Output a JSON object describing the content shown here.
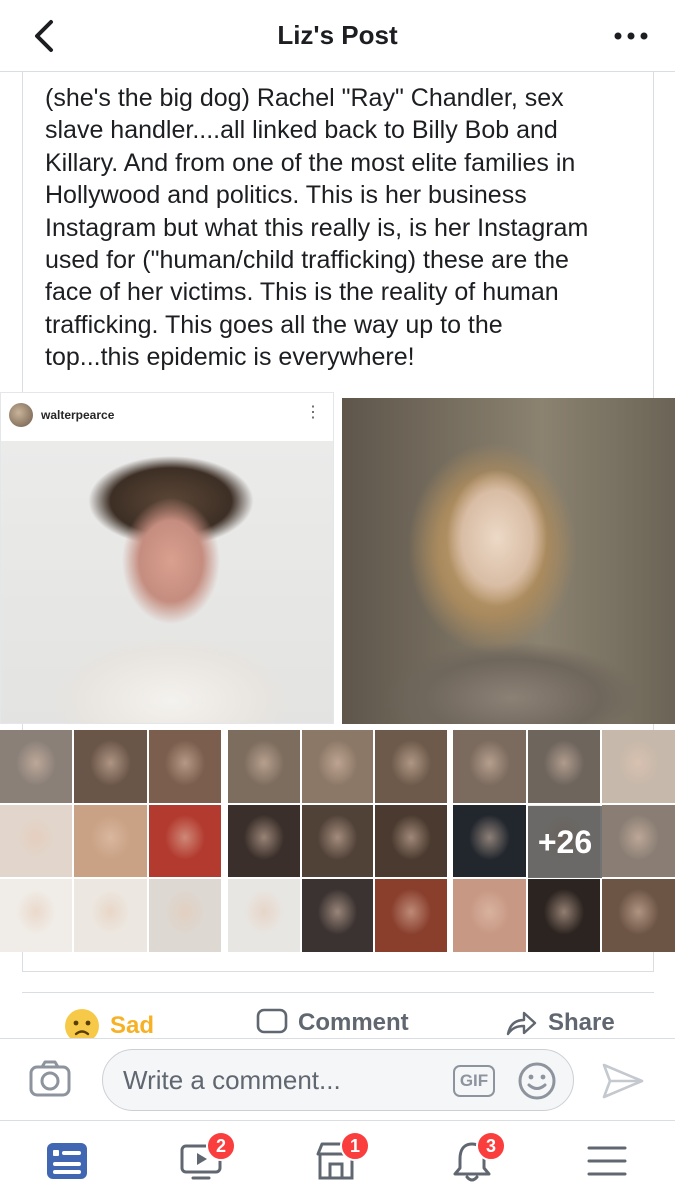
{
  "header": {
    "title": "Liz's Post"
  },
  "post": {
    "text": "(she's the big dog) Rachel \"Ray\" Chandler,  sex\nslave handler....all linked back to Billy Bob and\nKillary. And from one of the most elite families in\nHollywood and politics. This is her business\nInstagram but what this really is, is her Instagram\nused for (\"human/child trafficking) these are the\nface of her victims. This is the reality of human\ntrafficking. This goes all the way up to the\ntop...this epidemic is everywhere!",
    "photo_left": {
      "username": "walterpearce"
    },
    "more_photos": "+26"
  },
  "actions": {
    "reaction_label": "Sad",
    "comment_label": "Comment",
    "share_label": "Share"
  },
  "composer": {
    "placeholder": "Write a comment...",
    "gif_label": "GIF"
  },
  "bottom_nav": {
    "items": [
      {
        "name": "news-feed",
        "badge": ""
      },
      {
        "name": "watch",
        "badge": "2"
      },
      {
        "name": "marketplace",
        "badge": "1"
      },
      {
        "name": "notifications",
        "badge": "3"
      },
      {
        "name": "menu",
        "badge": ""
      }
    ]
  },
  "colors": {
    "accent": "#4267b2",
    "sad": "#f7b125",
    "badge": "#fa3e3e",
    "muted": "#606770"
  },
  "grid_tiles": {
    "g1": [
      "#8a8078",
      "#6a5648",
      "#7b5e4d",
      "#e2d6cc",
      "#c9a184",
      "#b23a2e",
      "#f0ede8",
      "#ece8e1",
      "#ddd8d1",
      "#2a2a2a",
      "#1f1f22",
      "#cfc7be"
    ],
    "g2": [
      "#7d6d5e",
      "#8c7867",
      "#6d5a4a",
      "#3a2f2a",
      "#514238",
      "#4a3a2f",
      "#e8e6e2",
      "#3b3331",
      "#8a3f2d",
      "#c88868",
      "#d7c9bd",
      "#cbb59d"
    ],
    "g3": [
      "#7b6b5e",
      "#6e655d",
      "#c6b8aa",
      "#22272e",
      "#ece9e4",
      "#8a7e74",
      "#c79884",
      "#2c2420",
      "#6d5545",
      "#2e2825",
      "#5a463c",
      "#b69480"
    ]
  }
}
